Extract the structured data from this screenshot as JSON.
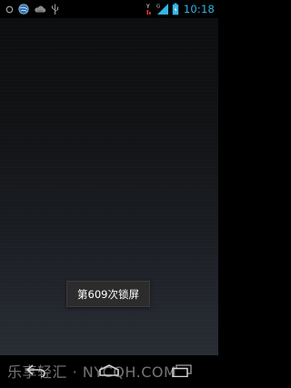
{
  "status_bar": {
    "time": "10:18",
    "accent_color": "#33b5e5",
    "left_icons": [
      "sync-circle-icon",
      "globe-icon",
      "cloud-icon",
      "usb-icon"
    ],
    "right_icons": [
      "signal-h-icon",
      "signal-strength-icon",
      "battery-icon"
    ],
    "network_label": "G"
  },
  "toast": {
    "message": "第609次锁屏"
  },
  "nav_bar": {
    "buttons": [
      "back-icon",
      "home-icon",
      "recent-apps-icon"
    ]
  },
  "watermark": {
    "text": "乐享轻汇 · NYCQH.COM"
  }
}
